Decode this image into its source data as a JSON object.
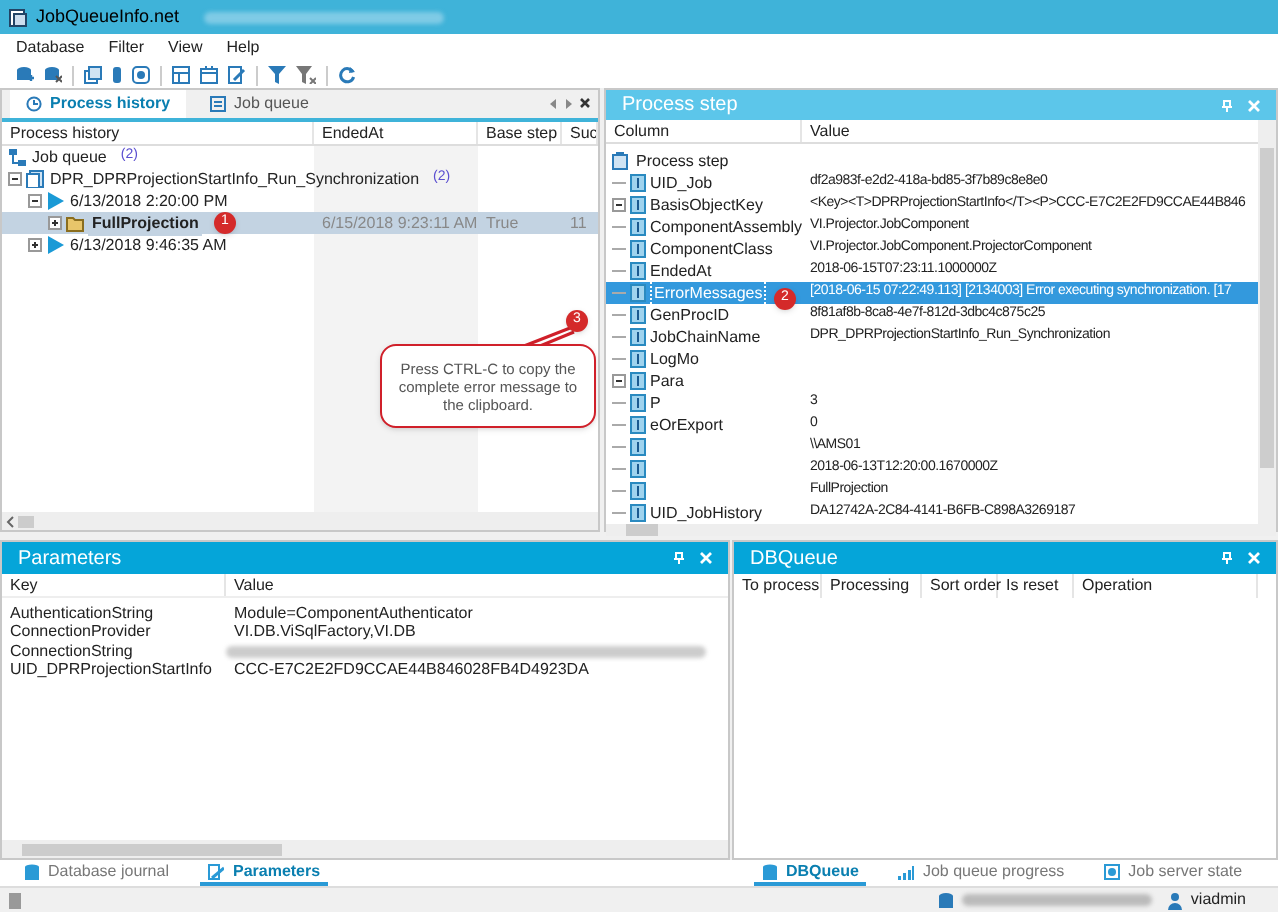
{
  "window": {
    "title": "JobQueueInfo.net"
  },
  "menu": [
    "Database",
    "Filter",
    "View",
    "Help"
  ],
  "history_panel": {
    "tabs": [
      {
        "label": "Process history",
        "selected": true
      },
      {
        "label": "Job queue",
        "selected": false
      }
    ],
    "columns": [
      "Process history",
      "EndedAt",
      "Base step",
      "Suc"
    ],
    "rows": [
      {
        "kind": "queue",
        "label": "Job queue",
        "count": "(2)",
        "selected": false
      },
      {
        "kind": "chain",
        "label": "DPR_DPRProjectionStartInfo_Run_Synchronization",
        "count": "(2)",
        "expanded": true,
        "selected": false,
        "children": [
          {
            "kind": "run",
            "label": "6/13/2018 2:20:00 PM",
            "expanded": true,
            "selected": false,
            "children": [
              {
                "kind": "step",
                "label": "FullProjection",
                "expanded": false,
                "selected": true,
                "ended_at": "6/15/2018 9:23:11 AM",
                "base_step": "True",
                "column_4": "11"
              }
            ]
          },
          {
            "kind": "run",
            "label": "6/13/2018 9:46:35 AM",
            "expanded": false,
            "selected": false
          }
        ]
      }
    ]
  },
  "step_panel": {
    "title": "Process step",
    "columns": [
      "Column",
      "Value"
    ],
    "root": "Process step",
    "rows": [
      {
        "name": "UID_Job",
        "value": "df2a983f-e2d2-418a-bd85-3f7b89c8e8e0",
        "selected": false
      },
      {
        "name": "BasisObjectKey",
        "value": "<Key><T>DPRProjectionStartInfo</T><P>CCC-E7C2E2FD9CCAE44B846",
        "expanded": true,
        "selected": false
      },
      {
        "name": "ComponentAssembly",
        "value": "VI.Projector.JobComponent",
        "selected": false
      },
      {
        "name": "ComponentClass",
        "value": "VI.Projector.JobComponent.ProjectorComponent",
        "selected": false
      },
      {
        "name": "EndedAt",
        "value": "2018-06-15T07:23:11.1000000Z",
        "selected": false
      },
      {
        "name": "ErrorMessages",
        "value": "[2018-06-15 07:22:49.113] [2134003] Error executing synchronization. [17",
        "selected": true
      },
      {
        "name": "GenProcID",
        "value": "8f81af8b-8ca8-4e7f-812d-3dbc4c875c25",
        "selected": false
      },
      {
        "name": "JobChainName",
        "value": "DPR_DPRProjectionStartInfo_Run_Synchronization",
        "selected": false
      },
      {
        "name": "LogMo",
        "selected": false
      },
      {
        "name": "Para",
        "expanded": true,
        "selected": false
      },
      {
        "name": "P",
        "value": "3",
        "selected": false
      },
      {
        "name": "eOrExport",
        "value": "0",
        "selected": false
      },
      {
        "value": "\\\\AMS01",
        "selected": false
      },
      {
        "value": "2018-06-13T12:20:00.1670000Z",
        "selected": false
      },
      {
        "value": "FullProjection",
        "selected": false
      },
      {
        "name": "UID_JobHistory",
        "value": "DA12742A-2C84-4141-B6FB-C898A3269187",
        "selected": false
      }
    ]
  },
  "annotations": {
    "markers": [
      "1",
      "2",
      "3"
    ],
    "callout": "Press CTRL-C to copy the complete error message to the clipboard."
  },
  "parameters_panel": {
    "title": "Parameters",
    "columns": [
      "Key",
      "Value"
    ],
    "rows": [
      {
        "key": "AuthenticationString",
        "value": "Module=ComponentAuthenticator"
      },
      {
        "key": "ConnectionProvider",
        "value": "VI.DB.ViSqlFactory,VI.DB"
      },
      {
        "key": "ConnectionString",
        "redacted": true
      },
      {
        "key": "UID_DPRProjectionStartInfo",
        "value": "CCC-E7C2E2FD9CCAE44B846028FB4D4923DA"
      }
    ],
    "tabs": [
      {
        "label": "Database journal",
        "selected": false
      },
      {
        "label": "Parameters",
        "selected": true
      }
    ]
  },
  "dbqueue_panel": {
    "title": "DBQueue",
    "columns": [
      "To process",
      "Processing",
      "Sort order",
      "Is reset",
      "Operation"
    ],
    "tabs": [
      {
        "label": "DBQueue",
        "selected": true
      },
      {
        "label": "Job queue progress",
        "selected": false
      },
      {
        "label": "Job server state",
        "selected": false
      }
    ]
  },
  "status_bar": {
    "user": "viadmin"
  }
}
